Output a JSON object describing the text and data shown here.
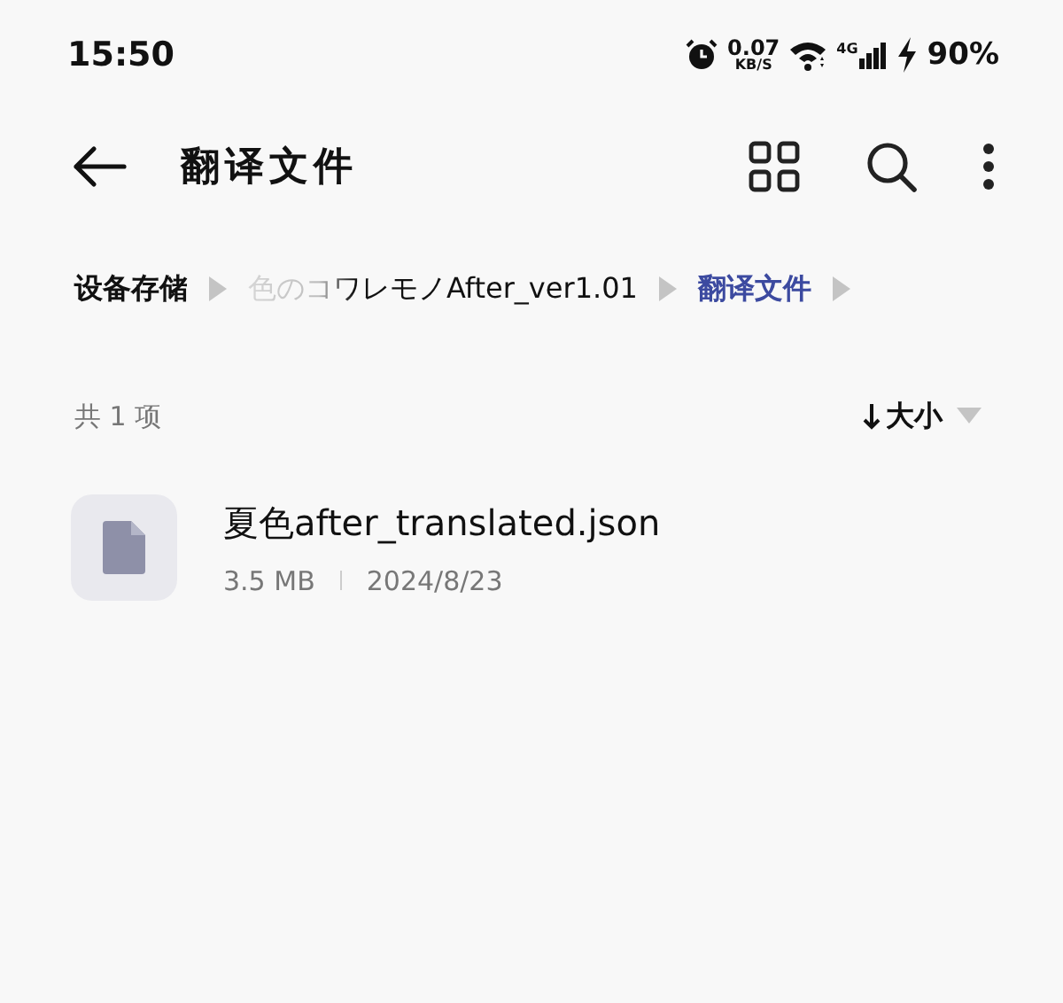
{
  "status_bar": {
    "time": "15:50",
    "speed_value": "0.07",
    "speed_unit": "KB/S",
    "network": "4G",
    "battery": "90%"
  },
  "app_bar": {
    "title": "翻译文件"
  },
  "breadcrumbs": [
    {
      "label": "设备存储",
      "selected": false,
      "faded": false
    },
    {
      "label": "色のコワレモノAfter_ver1.01",
      "selected": false,
      "faded": true
    },
    {
      "label": "翻译文件",
      "selected": true,
      "faded": false
    }
  ],
  "list_header": {
    "count": "共 1 项",
    "sort": "大小"
  },
  "files": [
    {
      "name": "夏色after_translated.json",
      "size": "3.5 MB",
      "date": "2024/8/23"
    }
  ]
}
